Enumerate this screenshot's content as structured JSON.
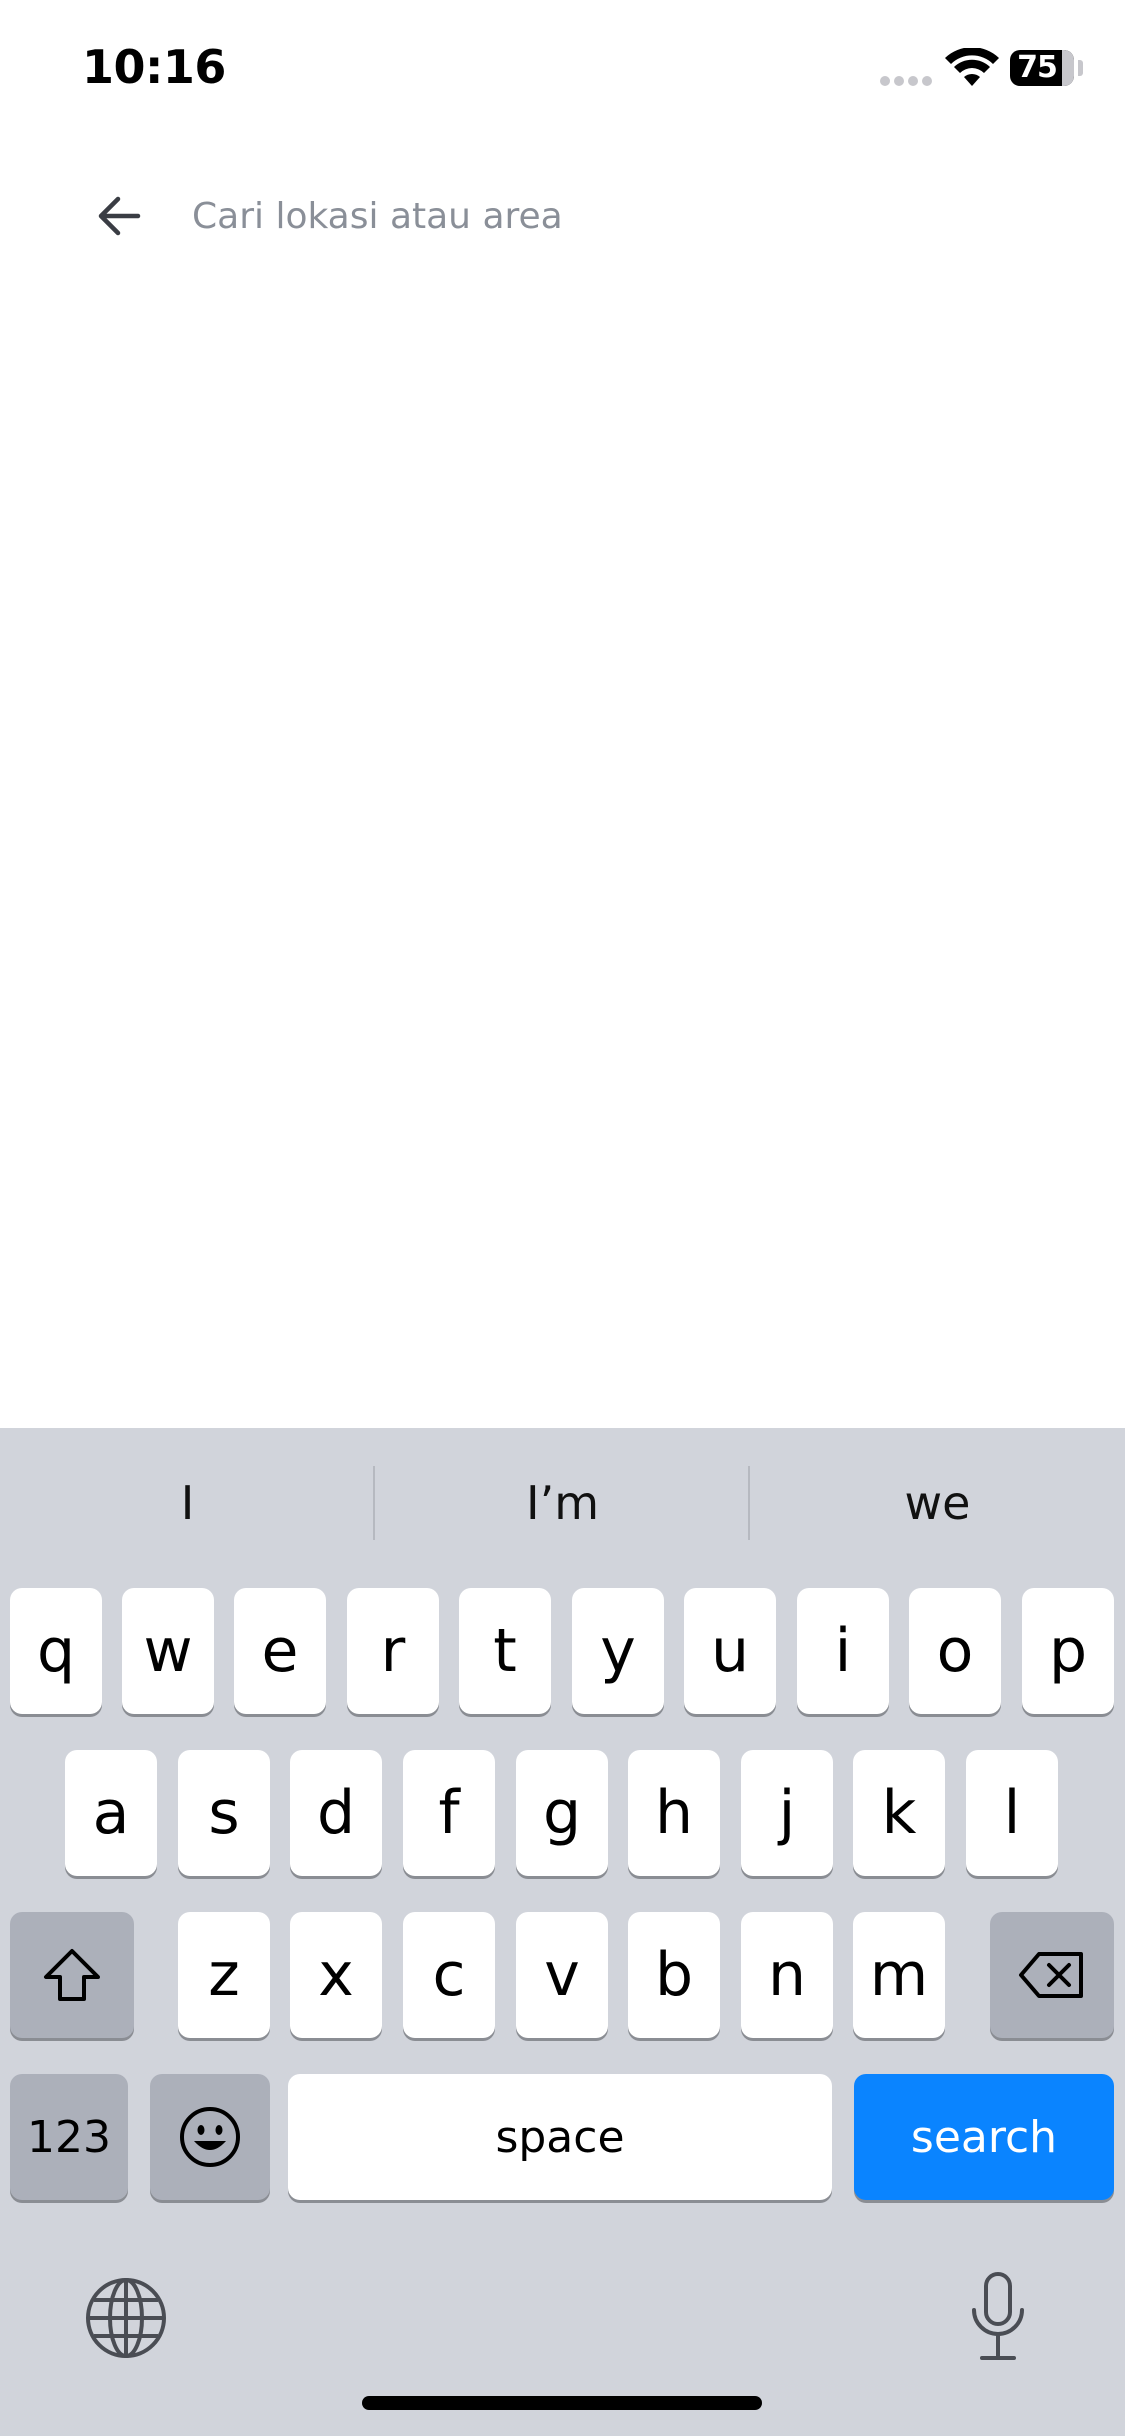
{
  "status_bar": {
    "time": "10:16",
    "battery": "75"
  },
  "search": {
    "placeholder": "Cari lokasi atau area",
    "value": ""
  },
  "keyboard": {
    "suggestions": [
      "I",
      "I’m",
      "we"
    ],
    "row1": [
      "q",
      "w",
      "e",
      "r",
      "t",
      "y",
      "u",
      "i",
      "o",
      "p"
    ],
    "row2": [
      "a",
      "s",
      "d",
      "f",
      "g",
      "h",
      "j",
      "k",
      "l"
    ],
    "row3": [
      "z",
      "x",
      "c",
      "v",
      "b",
      "n",
      "m"
    ],
    "numbers_label": "123",
    "space_label": "space",
    "action_label": "search",
    "action_color": "#0a84ff"
  }
}
